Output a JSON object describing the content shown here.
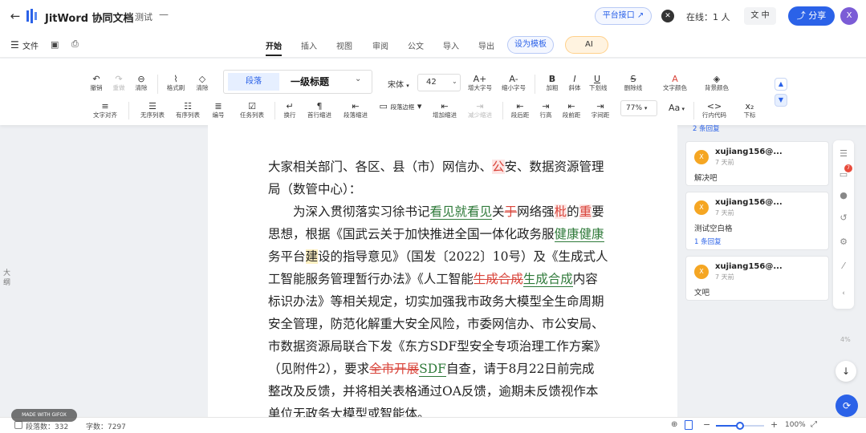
{
  "header": {
    "app_name": "JitWord 协同文档",
    "doc_name": "测试",
    "doc_suffix": "—",
    "platform_button": "平台接口 ↗",
    "online": "在线：1 人",
    "lang": "文 中",
    "share": "分享",
    "avatar": "X"
  },
  "menubar": {
    "file": "文件",
    "tabs": [
      "开始",
      "插入",
      "视图",
      "审阅",
      "公文",
      "导入",
      "导出"
    ],
    "active_tab": "开始",
    "template_button": "设为模板",
    "ai_button": "AI"
  },
  "toolbar": {
    "row1": [
      {
        "icon": "↶",
        "label": "撤销"
      },
      {
        "icon": "↷",
        "label": "重做"
      },
      {
        "icon": "⊖",
        "label": "清除"
      },
      {
        "icon": "⌇",
        "label": "格式刷"
      },
      {
        "icon": "◇",
        "label": "清除"
      }
    ],
    "style_para": "段落",
    "style_h1": "一级标题",
    "font": "宋体",
    "size": "42",
    "row1_right": [
      {
        "icon": "A+",
        "label": "增大字号"
      },
      {
        "icon": "A-",
        "label": "缩小字号"
      },
      {
        "icon": "B",
        "label": "加粗"
      },
      {
        "icon": "I",
        "label": "斜体"
      },
      {
        "icon": "U",
        "label": "下划线"
      },
      {
        "icon": "S",
        "label": "删除线"
      },
      {
        "icon": "A",
        "label": "文字颜色"
      },
      {
        "icon": "◈",
        "label": "背景颜色"
      }
    ],
    "row2": [
      {
        "icon": "≡",
        "label": "文字对齐"
      },
      {
        "icon": "☰",
        "label": "无序列表"
      },
      {
        "icon": "☷",
        "label": "有序列表"
      },
      {
        "icon": "≣",
        "label": "编号"
      },
      {
        "icon": "☑",
        "label": "任务列表"
      },
      {
        "icon": "↵",
        "label": "换行"
      },
      {
        "icon": "¶",
        "label": "首行缩进"
      },
      {
        "icon": "⇤",
        "label": "段落缩进"
      },
      {
        "icon": "▭",
        "label": "段落边框"
      },
      {
        "icon": "⇤",
        "label": "增加缩进"
      },
      {
        "icon": "⇥",
        "label": "减少缩进"
      },
      {
        "icon": "⇤",
        "label": "段后距"
      },
      {
        "icon": "⇥",
        "label": "行高"
      },
      {
        "icon": "⇤",
        "label": "段前距"
      },
      {
        "icon": "⇥",
        "label": "字间距"
      }
    ],
    "zoom": "77%",
    "row2_right": [
      {
        "icon": "Aa",
        "label": ""
      },
      {
        "icon": "<>",
        "label": "行内代码"
      },
      {
        "icon": "x₂",
        "label": "下标"
      }
    ]
  },
  "outline_label": "大纲",
  "document": {
    "lines": [
      [
        {
          "t": "大家相关部门、各区、县（市）网信办、",
          "k": ""
        },
        {
          "t": "公",
          "k": "hl-red"
        },
        {
          "t": "安、数据资源管理",
          "k": ""
        }
      ],
      [
        {
          "t": "局（数管中心）：",
          "k": ""
        }
      ],
      [
        {
          "t": "　　为深入贯彻落实习徐书记",
          "k": ""
        },
        {
          "t": "看见就看见",
          "k": "ins"
        },
        {
          "t": "关",
          "k": ""
        },
        {
          "t": "于",
          "k": "del"
        },
        {
          "t": "网络强",
          "k": ""
        },
        {
          "t": "枇",
          "k": "hl-red"
        },
        {
          "t": "的",
          "k": ""
        },
        {
          "t": "重",
          "k": "hl-red"
        },
        {
          "t": "要",
          "k": ""
        }
      ],
      [
        {
          "t": "思想，根据《国武云关于加快推进全国一体化政务服",
          "k": ""
        },
        {
          "t": "健康健康",
          "k": "ins"
        }
      ],
      [
        {
          "t": "务平台",
          "k": ""
        },
        {
          "t": "建",
          "k": "hl-yellow"
        },
        {
          "t": "设的指导意见》（国发〔2022〕10号）及《生成式人",
          "k": ""
        }
      ],
      [
        {
          "t": "工智能服务管理暂行办法》《人工智能",
          "k": ""
        },
        {
          "t": "生成合成",
          "k": "del"
        },
        {
          "t": "生成合成",
          "k": "ins"
        },
        {
          "t": "内容",
          "k": ""
        }
      ],
      [
        {
          "t": "标识办法》等相关规定，切实加强我市政务大模型全生命周期",
          "k": ""
        }
      ],
      [
        {
          "t": "安全管理，防范化解重大安全风险，市委网信办、市公安局、",
          "k": ""
        }
      ],
      [
        {
          "t": "市数据资源局联合下发《东方SDF型安全专项治理工作方案》",
          "k": ""
        }
      ],
      [
        {
          "t": "（见附件2），要求",
          "k": ""
        },
        {
          "t": "全市开展",
          "k": "del"
        },
        {
          "t": "SDF",
          "k": "ins"
        },
        {
          "t": "自查，请于8月22日前完成",
          "k": ""
        }
      ],
      [
        {
          "t": "整改及反馈，并将相关表格通过OA反馈，逾期未反馈视作本",
          "k": ""
        }
      ],
      [
        {
          "t": "单位无政务大模型或智能体。",
          "k": ""
        }
      ]
    ]
  },
  "comments": {
    "top_replies": "2 条回复",
    "items": [
      {
        "avatar": "X",
        "user": "xujiang156@...",
        "time": "7 天前",
        "text": "解决吧",
        "replies": ""
      },
      {
        "avatar": "X",
        "user": "xujiang156@...",
        "time": "7 天前",
        "text": "测试空白格",
        "replies": "1 条回复"
      },
      {
        "avatar": "X",
        "user": "xujiang156@...",
        "time": "7 天前",
        "text": "文吧",
        "replies": ""
      }
    ]
  },
  "rail": {
    "badge": "7",
    "zoom_pct": "4%"
  },
  "status": {
    "paragraphs": "段落数：332",
    "chars": "字数：7297",
    "zoom": "100%",
    "zoom_level": 0.5,
    "watermark": "MADE WITH GIFOX"
  }
}
